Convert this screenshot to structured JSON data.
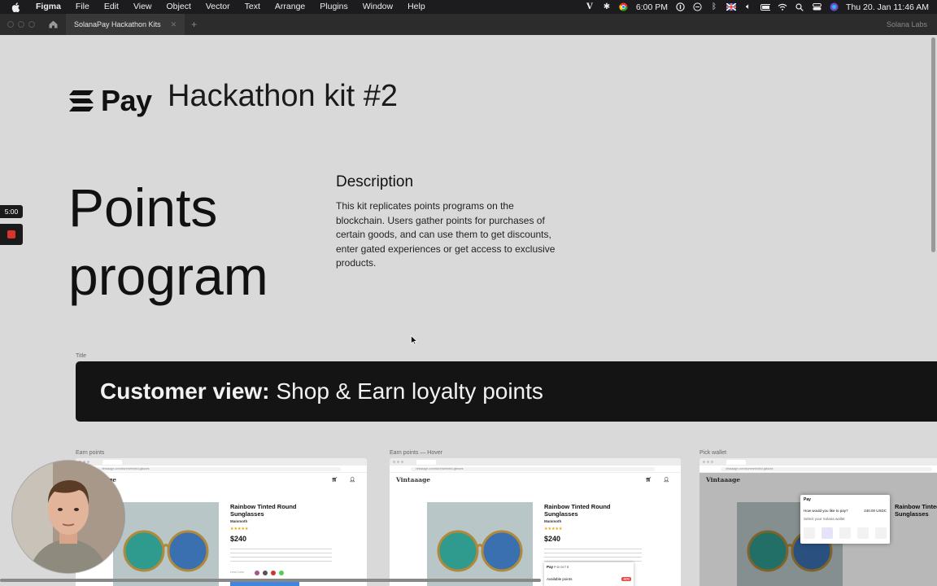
{
  "menubar": {
    "app_name": "Figma",
    "items": [
      "File",
      "Edit",
      "View",
      "Object",
      "Vector",
      "Text",
      "Arrange",
      "Plugins",
      "Window",
      "Help"
    ],
    "clock_widget": "6:00 PM",
    "datetime": "Thu 20. Jan  11:46 AM"
  },
  "tabbar": {
    "active_tab": "SolanaPay Hackathon Kits",
    "team": "Solana Labs"
  },
  "canvas": {
    "logo_text": "Pay",
    "heading": "Hackathon kit #2",
    "big_title_line1": "Points",
    "big_title_line2": "program",
    "description_heading": "Description",
    "description_body": "This kit replicates points programs on the blockchain. Users gather points for purchases of certain goods, and can use them to get discounts, enter gated experiences or get access to exclusive products.",
    "title_frame_label": "Title",
    "banner_bold": "Customer view:",
    "banner_rest": "Shop & Earn loyalty points",
    "frames": [
      {
        "label": "Earn points"
      },
      {
        "label": "Earn points — Hover"
      },
      {
        "label": "Pick wallet"
      }
    ],
    "mock": {
      "shop_name": "Vintaaage",
      "url": "vintaaage.com/store/selected-glasses",
      "product_title": "Rainbow Tinted Round Sunglasses",
      "brand": "Mammoth",
      "stars": "★★★★★",
      "price": "$240",
      "lens_label": "Lens Color",
      "popup_brand": "Pay",
      "popup_points_title": "POINTS",
      "popup_available": "Available points",
      "popup_points_value": "600",
      "modal_title": "Pay",
      "modal_question": "How would you like to pay?",
      "modal_amount": "240.00 USDC",
      "modal_select": "Select your Solana wallet"
    }
  },
  "recording": {
    "timer": "5:00"
  },
  "colors": {
    "canvas_bg": "#d9d9d9",
    "banner_bg": "#141414",
    "buy_button": "#3f86e0",
    "record": "#d9342b"
  }
}
